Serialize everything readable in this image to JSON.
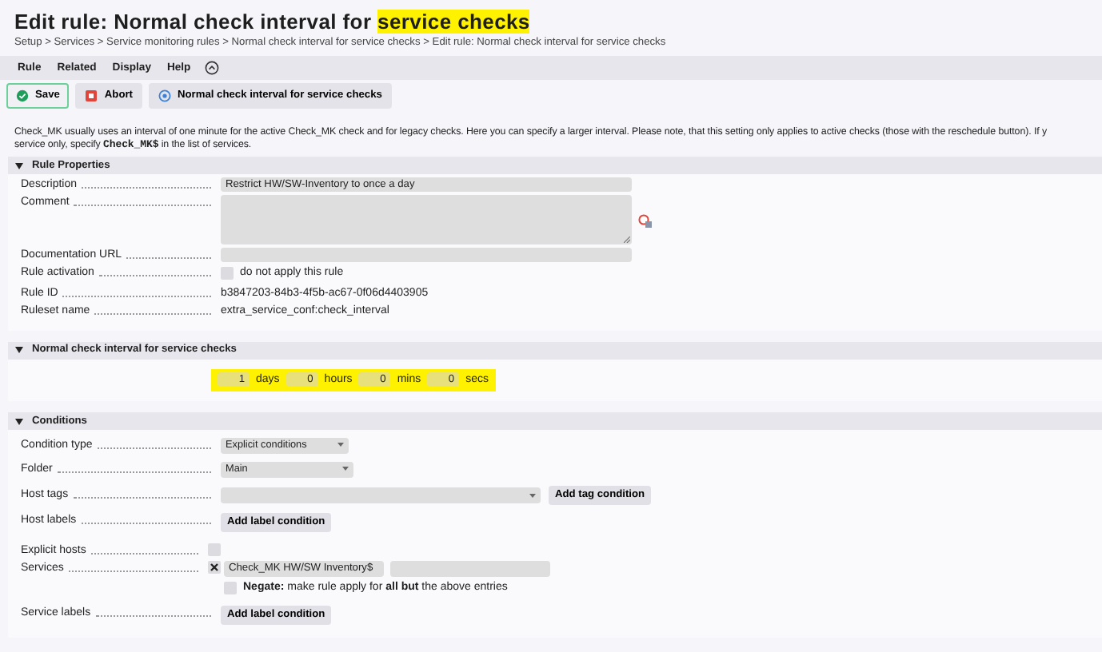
{
  "title": [
    {
      "text": "Edit rule: Normal check interval for ",
      "highlighted": false
    },
    {
      "text": "service checks",
      "highlighted": true
    }
  ],
  "breadcrumb": "Setup > Services > Service monitoring rules > Normal check interval for service checks > Edit rule: Normal check interval for service checks",
  "menu": [
    {
      "label": "Rule"
    },
    {
      "label": "Related"
    },
    {
      "label": "Display"
    },
    {
      "label": "Help"
    }
  ],
  "buttons": [
    {
      "label": "Save",
      "kind": "save"
    },
    {
      "label": "Abort",
      "kind": "abort"
    },
    {
      "label": "Normal check interval for service checks",
      "kind": "link"
    }
  ],
  "intro": [
    "Check_MK usually uses an interval of one minute for the active Check_MK check and for legacy checks. Here you can specify a larger interval. Please note, that this setting only applies to active checks (those with the reschedule button). If y",
    "service only, specify **Check_MK$** in the list of services."
  ],
  "sections": [
    {
      "title": "Rule Properties",
      "expanded": true,
      "kind": "form",
      "rows": [
        {
          "label": "Description",
          "kind": "input",
          "value": "Restrict HW/SW-Inventory to once a day"
        },
        {
          "label": "Comment",
          "kind": "textarea"
        },
        {
          "label": "Documentation URL",
          "kind": "input"
        },
        {
          "label": "Rule activation",
          "kind": "checkbox",
          "checked": false,
          "text": "do not apply this rule"
        },
        {
          "label": "Rule ID",
          "kind": "text",
          "value": "b3847203-84b3-4f5b-ac67-0f06d4403905"
        },
        {
          "label": "Ruleset name",
          "kind": "text",
          "value": "extra_service_conf:check_interval"
        }
      ]
    },
    {
      "title": "Normal check interval for service checks",
      "expanded": true,
      "kind": "interval",
      "highlighted": true,
      "fields": [
        {
          "value": "1",
          "unit": "days"
        },
        {
          "value": "0",
          "unit": "hours"
        },
        {
          "value": "0",
          "unit": "mins"
        },
        {
          "value": "0",
          "unit": "secs"
        }
      ]
    },
    {
      "title": "Conditions",
      "expanded": true,
      "kind": "form",
      "rows": [
        {
          "label": "Condition type",
          "kind": "select",
          "value": "Explicit conditions"
        },
        {
          "label": "Folder",
          "kind": "select",
          "value": "Main"
        },
        {
          "label": "Host tags",
          "kind": "select-button",
          "button": "Add tag condition"
        },
        {
          "label": "Host labels",
          "kind": "button",
          "button": "Add label condition"
        },
        {
          "label": "Explicit hosts",
          "kind": "toggle",
          "checked": false
        },
        {
          "label": "Services",
          "kind": "services",
          "checked": true,
          "entries": [
            "Check_MK HW/SW Inventory$"
          ],
          "negate": {
            "checked": false,
            "text": "**Negate:** make rule apply for **all but** the above entries"
          }
        },
        {
          "label": "Service labels",
          "kind": "button",
          "button": "Add label condition"
        }
      ]
    }
  ]
}
